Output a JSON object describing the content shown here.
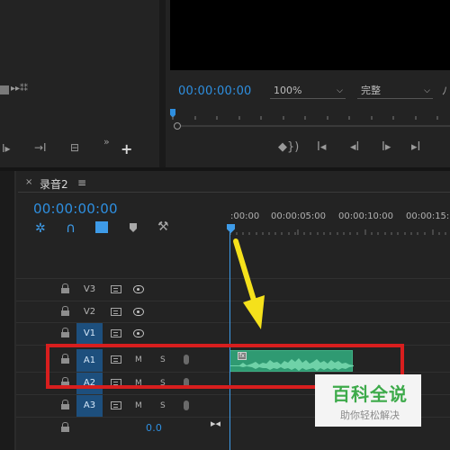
{
  "program": {
    "timecode": "00:00:00:00",
    "zoom": "100%",
    "quality": "完整"
  },
  "timeline": {
    "tab_title": "录音2",
    "timecode": "00:00:00:00",
    "ruler_labels": [
      ":00:00",
      "00:00:05:00",
      "00:00:10:00",
      "00:00:15:"
    ]
  },
  "tracks": {
    "video": [
      "V3",
      "V2",
      "V1"
    ],
    "audio": [
      {
        "name": "A1",
        "m": "M",
        "s": "S"
      },
      {
        "name": "A2",
        "m": "M",
        "s": "S"
      },
      {
        "name": "A3",
        "m": "M",
        "s": "S"
      }
    ],
    "master_value": "0.0"
  },
  "clip": {
    "fx_badge": "fx"
  },
  "watermark": {
    "title": "百科全说",
    "subtitle": "助你轻松解决"
  },
  "colors": {
    "accent_blue": "#2e8fe0",
    "highlight_red": "#d81e1e",
    "arrow_yellow": "#f5e11b",
    "clip_green": "#2f9a72",
    "watermark_green": "#3daa4a"
  }
}
